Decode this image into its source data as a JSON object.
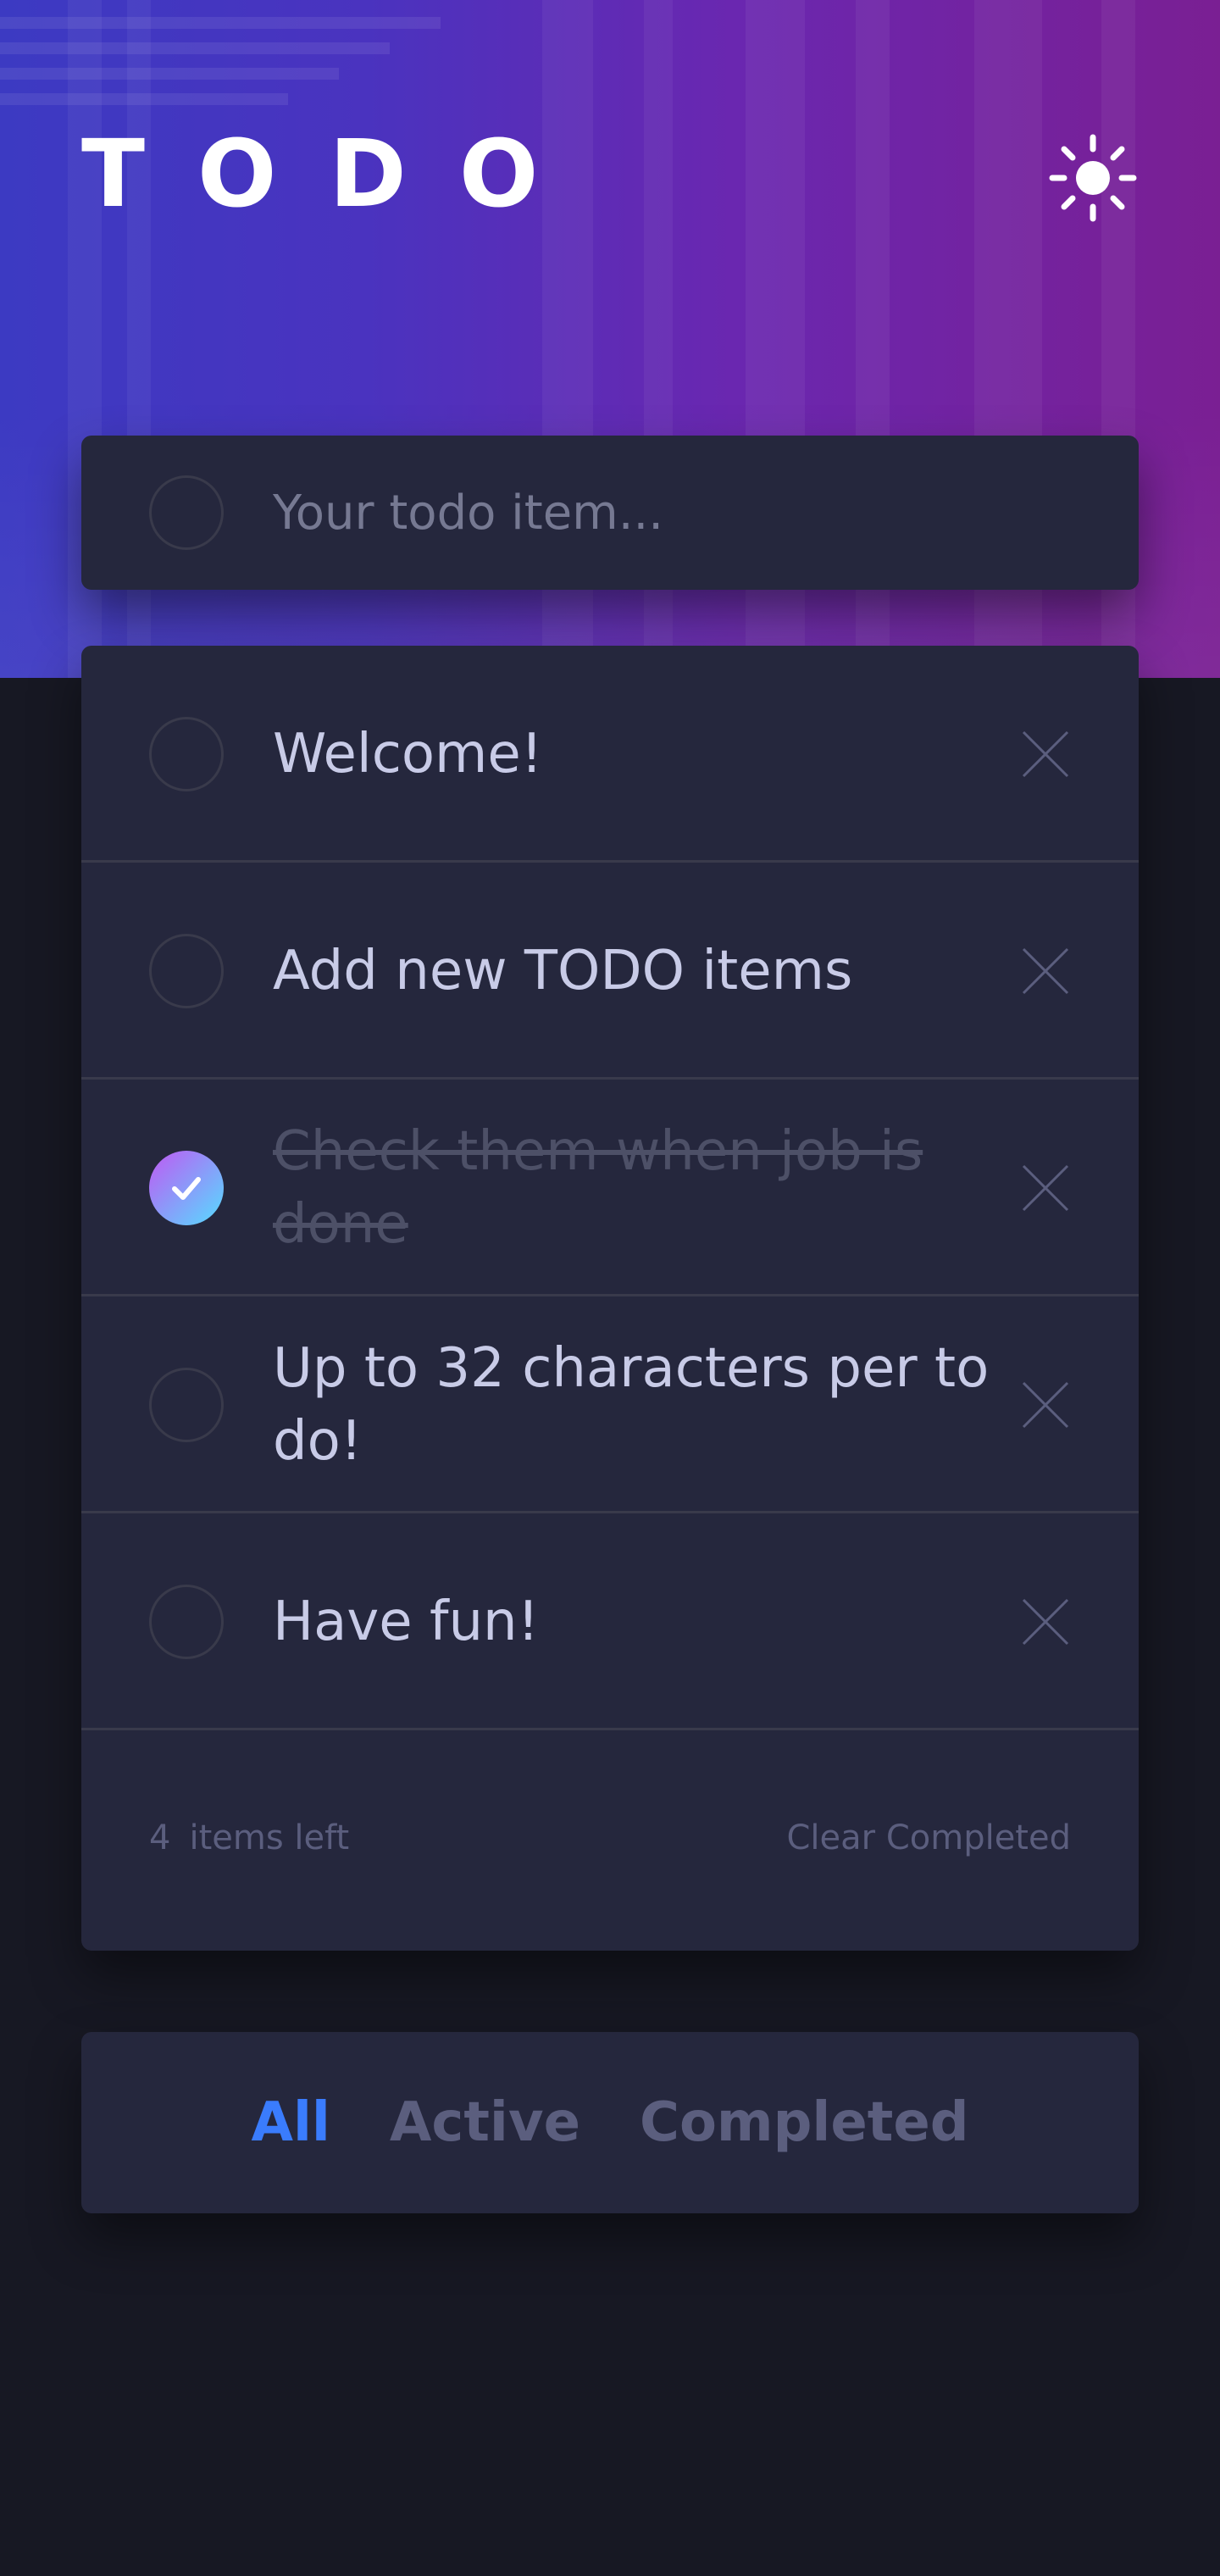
{
  "header": {
    "title": "TODO",
    "theme_icon": "sun-icon"
  },
  "new_todo": {
    "placeholder": "Your todo item...",
    "value": ""
  },
  "todos": [
    {
      "text": "Welcome!",
      "completed": false
    },
    {
      "text": "Add new TODO items",
      "completed": false
    },
    {
      "text": "Check them when job is done",
      "completed": true
    },
    {
      "text": "Up to 32 characters per to do!",
      "completed": false
    },
    {
      "text": "Have fun!",
      "completed": false
    }
  ],
  "footer": {
    "count": "4",
    "items_left_label": "items left",
    "clear_label": "Clear Completed"
  },
  "filters": [
    {
      "label": "All",
      "active": true
    },
    {
      "label": "Active",
      "active": false
    },
    {
      "label": "Completed",
      "active": false
    }
  ],
  "colors": {
    "background": "#171823",
    "card": "#25273d",
    "active_filter": "#3a7cfd",
    "check_gradient_start": "#55ddff",
    "check_gradient_end": "#c058f3"
  }
}
